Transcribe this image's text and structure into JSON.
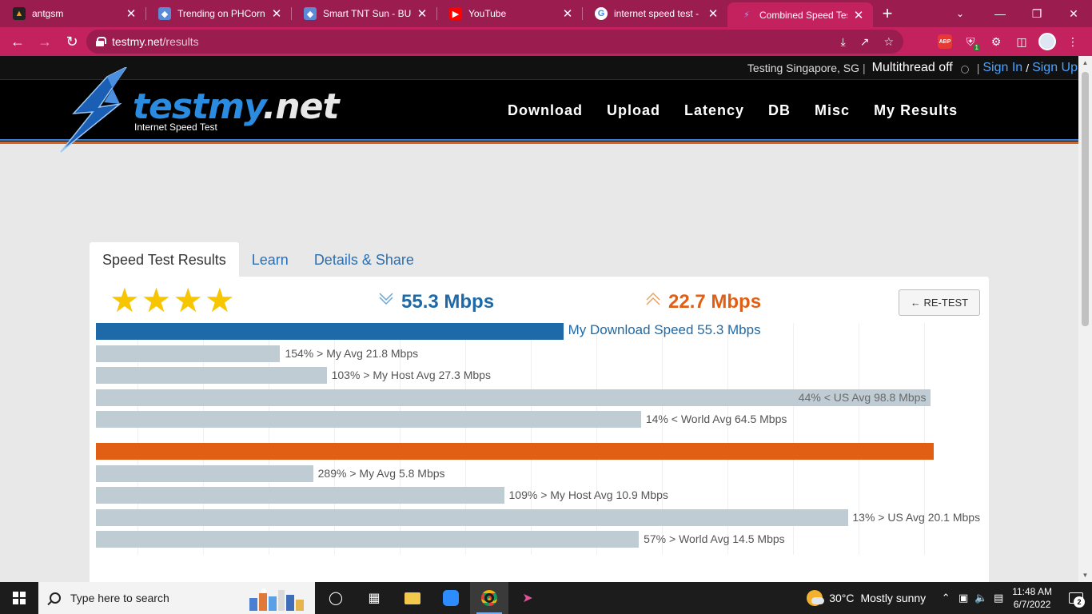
{
  "browser": {
    "tabs": [
      {
        "title": "antgsm",
        "favicon": "antgsm-icon",
        "active": false
      },
      {
        "title": "Trending on PHCorner",
        "favicon": "phcorner-icon",
        "active": false
      },
      {
        "title": "Smart TNT Sun - BUMP",
        "favicon": "phcorner-icon",
        "active": false
      },
      {
        "title": "YouTube",
        "favicon": "youtube-icon",
        "active": false
      },
      {
        "title": "internet speed test - Google",
        "favicon": "google-icon",
        "active": false
      },
      {
        "title": "Combined Speed Test",
        "favicon": "testmy-icon",
        "active": true
      }
    ],
    "url_host": "testmy.net",
    "url_path": "/results",
    "extension_abp": "ABP",
    "extension_badge": "1"
  },
  "site": {
    "top_testing": "Testing Singapore, SG",
    "top_sep": "|",
    "top_multithread": "Multithread off",
    "top_signin": "Sign In",
    "top_slash": "/",
    "top_signup": "Sign Up",
    "logo_main": "testmy",
    "logo_dot": ".net",
    "logo_sub": "Internet Speed Test",
    "menu": [
      "Download",
      "Upload",
      "Latency",
      "DB",
      "Misc",
      "My Results"
    ]
  },
  "results": {
    "tabs": [
      "Speed Test Results",
      "Learn",
      "Details & Share"
    ],
    "stars": 4,
    "download_value": "55.3 Mbps",
    "upload_value": "22.7 Mbps",
    "retest_label": "← RE-TEST",
    "colors": {
      "download": "#1e6aa8",
      "upload": "#e15f14",
      "compare": "#bfccd4"
    }
  },
  "chart_data": {
    "type": "bar",
    "orientation": "horizontal",
    "groups": [
      {
        "name": "Download",
        "bars": [
          {
            "label": "My Download Speed 55.3 Mbps",
            "value": 55.3,
            "kind": "primary"
          },
          {
            "label": "154% > My Avg 21.8 Mbps",
            "value": 21.8,
            "kind": "compare"
          },
          {
            "label": "103% > My Host Avg 27.3 Mbps",
            "value": 27.3,
            "kind": "compare"
          },
          {
            "label": "44% < US Avg 98.8 Mbps",
            "value": 98.8,
            "kind": "compare"
          },
          {
            "label": "14% < World Avg 64.5 Mbps",
            "value": 64.5,
            "kind": "compare"
          }
        ],
        "max": 105
      },
      {
        "name": "Upload",
        "bars": [
          {
            "label": "",
            "value": 22.7,
            "kind": "primary"
          },
          {
            "label": "289% > My Avg 5.8 Mbps",
            "value": 5.8,
            "kind": "compare"
          },
          {
            "label": "109% > My Host Avg 10.9 Mbps",
            "value": 10.9,
            "kind": "compare"
          },
          {
            "label": "13% > US Avg 20.1 Mbps",
            "value": 20.1,
            "kind": "compare"
          },
          {
            "label": "57% > World Avg 14.5 Mbps",
            "value": 14.5,
            "kind": "compare"
          }
        ],
        "max": 23.7
      }
    ]
  },
  "taskbar": {
    "search_placeholder": "Type here to search",
    "weather_temp": "30°C",
    "weather_desc": "Mostly sunny",
    "time": "11:48 AM",
    "date": "6/7/2022",
    "notifications": "2"
  }
}
